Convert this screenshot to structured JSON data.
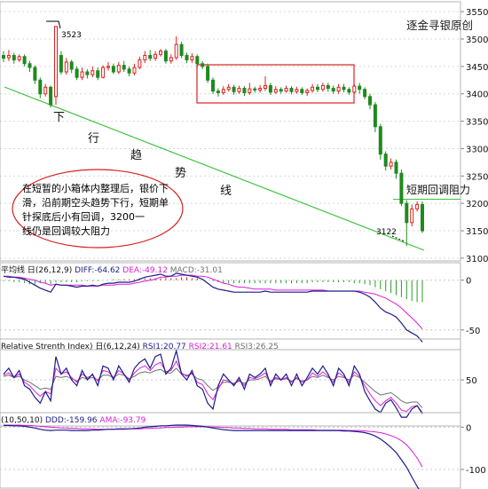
{
  "chart_data": [
    {
      "type": "candlestick",
      "watermark": "逐金寻银原创",
      "y_ticks": [
        3550,
        3500,
        3450,
        3400,
        3350,
        3300,
        3250,
        3200,
        3150,
        3100
      ],
      "ylim": [
        3095,
        3568
      ],
      "candles": [
        [
          3470,
          3465,
          3478,
          3458
        ],
        [
          3466,
          3470,
          3480,
          3460
        ],
        [
          3470,
          3462,
          3475,
          3455
        ],
        [
          3462,
          3468,
          3472,
          3458
        ],
        [
          3468,
          3455,
          3472,
          3450
        ],
        [
          3455,
          3448,
          3460,
          3440
        ],
        [
          3448,
          3425,
          3452,
          3418
        ],
        [
          3425,
          3400,
          3430,
          3392
        ],
        [
          3400,
          3412,
          3418,
          3395
        ],
        [
          3412,
          3380,
          3415,
          3375
        ],
        [
          3395,
          3523,
          3523,
          3380
        ],
        [
          3470,
          3440,
          3478,
          3435
        ],
        [
          3440,
          3458,
          3465,
          3435
        ],
        [
          3458,
          3445,
          3462,
          3438
        ],
        [
          3445,
          3430,
          3450,
          3425
        ],
        [
          3430,
          3440,
          3448,
          3425
        ],
        [
          3440,
          3435,
          3445,
          3428
        ],
        [
          3435,
          3442,
          3450,
          3430
        ],
        [
          3442,
          3430,
          3448,
          3425
        ],
        [
          3430,
          3448,
          3452,
          3428
        ],
        [
          3448,
          3450,
          3458,
          3442
        ],
        [
          3450,
          3440,
          3455,
          3436
        ],
        [
          3440,
          3452,
          3458,
          3436
        ],
        [
          3452,
          3445,
          3460,
          3440
        ],
        [
          3445,
          3438,
          3450,
          3432
        ],
        [
          3438,
          3448,
          3455,
          3434
        ],
        [
          3448,
          3462,
          3468,
          3445
        ],
        [
          3462,
          3470,
          3478,
          3456
        ],
        [
          3470,
          3465,
          3480,
          3460
        ],
        [
          3465,
          3472,
          3478,
          3460
        ],
        [
          3472,
          3478,
          3482,
          3468
        ],
        [
          3478,
          3460,
          3482,
          3455
        ],
        [
          3460,
          3466,
          3472,
          3455
        ],
        [
          3466,
          3490,
          3505,
          3462
        ],
        [
          3490,
          3470,
          3495,
          3465
        ],
        [
          3470,
          3462,
          3475,
          3456
        ],
        [
          3462,
          3468,
          3474,
          3456
        ],
        [
          3468,
          3455,
          3472,
          3448
        ],
        [
          3455,
          3450,
          3460,
          3445
        ],
        [
          3450,
          3425,
          3455,
          3420
        ],
        [
          3425,
          3405,
          3430,
          3400
        ],
        [
          3405,
          3402,
          3410,
          3395
        ],
        [
          3402,
          3408,
          3414,
          3398
        ],
        [
          3408,
          3412,
          3418,
          3404
        ],
        [
          3412,
          3404,
          3416,
          3398
        ],
        [
          3404,
          3410,
          3415,
          3400
        ],
        [
          3410,
          3402,
          3414,
          3396
        ],
        [
          3402,
          3409,
          3420,
          3398
        ],
        [
          3409,
          3407,
          3413,
          3402
        ],
        [
          3407,
          3410,
          3416,
          3402
        ],
        [
          3410,
          3415,
          3432,
          3405
        ],
        [
          3415,
          3403,
          3420,
          3398
        ],
        [
          3403,
          3408,
          3414,
          3400
        ],
        [
          3408,
          3405,
          3412,
          3400
        ],
        [
          3405,
          3410,
          3415,
          3402
        ],
        [
          3410,
          3404,
          3414,
          3399
        ],
        [
          3404,
          3408,
          3413,
          3400
        ],
        [
          3408,
          3402,
          3412,
          3398
        ],
        [
          3402,
          3406,
          3410,
          3396
        ],
        [
          3406,
          3412,
          3418,
          3402
        ],
        [
          3412,
          3408,
          3418,
          3403
        ],
        [
          3408,
          3415,
          3420,
          3404
        ],
        [
          3415,
          3410,
          3420,
          3404
        ],
        [
          3410,
          3405,
          3415,
          3400
        ],
        [
          3405,
          3412,
          3418,
          3400
        ],
        [
          3412,
          3408,
          3418,
          3403
        ],
        [
          3408,
          3403,
          3412,
          3398
        ],
        [
          3403,
          3414,
          3418,
          3400
        ],
        [
          3414,
          3408,
          3420,
          3400
        ],
        [
          3408,
          3395,
          3412,
          3390
        ],
        [
          3395,
          3380,
          3400,
          3372
        ],
        [
          3380,
          3340,
          3385,
          3330
        ],
        [
          3340,
          3290,
          3345,
          3280
        ],
        [
          3290,
          3268,
          3295,
          3260
        ],
        [
          3268,
          3275,
          3282,
          3262
        ],
        [
          3275,
          3255,
          3280,
          3245
        ],
        [
          3255,
          3200,
          3262,
          3195
        ],
        [
          3200,
          3165,
          3206,
          3122
        ],
        [
          3165,
          3190,
          3198,
          3158
        ],
        [
          3190,
          3198,
          3204,
          3185
        ],
        [
          3198,
          3150,
          3204,
          3146
        ]
      ],
      "annotations": {
        "high_label": "3523",
        "low_label": "3122",
        "trend_chars": [
          "下",
          "行",
          "趋",
          "势",
          "线"
        ],
        "resistance_label": "短期回调阻力",
        "note": "在短暂的小箱体内整理后，银价下滑，沿前期空头趋势下行，短期单针探底后小有回调，3200一线仍是回调较大阻力"
      }
    },
    {
      "type": "line",
      "indicator": "MACD",
      "title": "平均线 日(26,12,9)",
      "legend": [
        {
          "name": "DIFF",
          "value": "-64.62",
          "color": "#1c1c8a"
        },
        {
          "name": "DEA",
          "value": "-49.12",
          "color": "#d81ed8"
        },
        {
          "name": "MACD",
          "value": "-31.01",
          "color": "#707070"
        }
      ],
      "y_ticks": [
        0,
        -50
      ],
      "ylim": [
        -68,
        14
      ],
      "histogram": [
        -1,
        -1,
        -2,
        -2,
        -3,
        -4,
        -4,
        -3,
        -3,
        -4,
        -2,
        -2,
        -2,
        -2,
        -2,
        -1,
        -1,
        -1,
        -1,
        0,
        0,
        1,
        1,
        1,
        1,
        1,
        2,
        2,
        2,
        2,
        2,
        2,
        2,
        2,
        3,
        3,
        2,
        2,
        1,
        0,
        -1,
        -2,
        -3,
        -3,
        -3,
        -3,
        -3,
        -3,
        -3,
        -3,
        -3,
        -3,
        -3,
        -3,
        -3,
        -3,
        -3,
        -3,
        -3,
        -2,
        -2,
        -2,
        -2,
        -2,
        -2,
        -2,
        -2,
        -3,
        -3,
        -4,
        -5,
        -7,
        -9,
        -11,
        -13,
        -15,
        -17,
        -19,
        -21,
        -22,
        -22
      ],
      "diff": [
        4,
        3,
        3,
        2,
        1,
        -2,
        -5,
        -8,
        -10,
        -12,
        -4,
        -5,
        -5,
        -6,
        -7,
        -6,
        -6,
        -5,
        -6,
        -4,
        -3,
        -3,
        -2,
        -2,
        -2,
        -1,
        1,
        3,
        4,
        5,
        6,
        4,
        4,
        7,
        6,
        5,
        4,
        3,
        1,
        -3,
        -7,
        -9,
        -10,
        -11,
        -12,
        -12,
        -12,
        -12,
        -12,
        -12,
        -11,
        -12,
        -12,
        -12,
        -12,
        -12,
        -12,
        -12,
        -12,
        -11,
        -11,
        -11,
        -11,
        -11,
        -11,
        -11,
        -11,
        -11,
        -12,
        -14,
        -17,
        -22,
        -28,
        -32,
        -34,
        -37,
        -43,
        -50,
        -53,
        -56,
        -62
      ],
      "dea": [
        4,
        4,
        3,
        3,
        2,
        1,
        0,
        -2,
        -3,
        -5,
        -4,
        -5,
        -5,
        -5,
        -5,
        -5,
        -6,
        -6,
        -6,
        -5,
        -5,
        -5,
        -4,
        -4,
        -4,
        -3,
        -2,
        -1,
        0,
        1,
        3,
        3,
        4,
        4,
        5,
        5,
        5,
        4,
        4,
        3,
        1,
        -1,
        -3,
        -4,
        -6,
        -7,
        -7,
        -8,
        -9,
        -9,
        -9,
        -9,
        -10,
        -10,
        -10,
        -10,
        -10,
        -10,
        -10,
        -10,
        -10,
        -10,
        -11,
        -11,
        -11,
        -11,
        -11,
        -11,
        -11,
        -12,
        -13,
        -14,
        -16,
        -18,
        -21,
        -24,
        -28,
        -33,
        -38,
        -43,
        -49
      ]
    },
    {
      "type": "line",
      "indicator": "RSI",
      "title": "Relative Strenth Index) 日(6,12,24)",
      "legend": [
        {
          "name": "RSI1",
          "value": "20.77",
          "color": "#1c1c8a"
        },
        {
          "name": "RSI2",
          "value": "21.61",
          "color": "#d81ed8"
        },
        {
          "name": "RSI3",
          "value": "26.25",
          "color": "#707070"
        }
      ],
      "y_ticks": [
        50
      ],
      "ylim": [
        12,
        82
      ],
      "rsi1": [
        55,
        60,
        52,
        58,
        45,
        42,
        35,
        30,
        40,
        32,
        70,
        55,
        60,
        50,
        45,
        58,
        50,
        55,
        45,
        62,
        60,
        50,
        62,
        55,
        48,
        60,
        65,
        68,
        60,
        70,
        72,
        55,
        60,
        75,
        55,
        50,
        58,
        45,
        42,
        30,
        25,
        45,
        55,
        50,
        45,
        52,
        42,
        55,
        52,
        55,
        60,
        45,
        55,
        50,
        55,
        45,
        55,
        45,
        52,
        60,
        55,
        62,
        55,
        45,
        60,
        55,
        45,
        62,
        55,
        40,
        32,
        25,
        22,
        30,
        33,
        26,
        18,
        18,
        25,
        28,
        21
      ],
      "rsi2": [
        54,
        56,
        52,
        55,
        48,
        45,
        40,
        36,
        40,
        38,
        60,
        55,
        57,
        52,
        48,
        55,
        52,
        54,
        49,
        58,
        57,
        52,
        58,
        55,
        50,
        56,
        60,
        62,
        58,
        63,
        65,
        57,
        58,
        66,
        56,
        53,
        56,
        48,
        46,
        38,
        33,
        42,
        50,
        49,
        46,
        50,
        45,
        52,
        51,
        53,
        56,
        48,
        52,
        50,
        52,
        48,
        52,
        48,
        50,
        56,
        53,
        57,
        53,
        48,
        56,
        53,
        48,
        57,
        53,
        45,
        38,
        32,
        28,
        32,
        35,
        30,
        24,
        23,
        27,
        28,
        22
      ],
      "rsi3": [
        53,
        54,
        52,
        53,
        50,
        48,
        45,
        42,
        43,
        42,
        53,
        52,
        53,
        51,
        49,
        52,
        51,
        52,
        50,
        54,
        54,
        52,
        55,
        54,
        51,
        53,
        56,
        57,
        56,
        58,
        59,
        56,
        56,
        60,
        55,
        54,
        55,
        51,
        50,
        45,
        41,
        44,
        48,
        48,
        47,
        49,
        47,
        50,
        50,
        51,
        53,
        49,
        51,
        50,
        51,
        49,
        51,
        49,
        50,
        53,
        52,
        54,
        52,
        50,
        53,
        52,
        50,
        54,
        52,
        48,
        44,
        40,
        37,
        38,
        39,
        36,
        32,
        30,
        31,
        31,
        26
      ]
    },
    {
      "type": "line",
      "indicator": "DMA",
      "title": "(10,50,10)",
      "legend": [
        {
          "name": "DDD",
          "value": "-159.96",
          "color": "#1c1c8a"
        },
        {
          "name": "AMA",
          "value": "-93.79",
          "color": "#d81ed8"
        }
      ],
      "y_ticks": [
        0,
        -100
      ],
      "ylim": [
        -140,
        28
      ],
      "ddd": [
        4,
        4,
        3,
        3,
        2,
        0,
        -2,
        -5,
        -7,
        -8,
        -7,
        -7,
        -7,
        -8,
        -8,
        -8,
        -8,
        -7,
        -7,
        -6,
        -5,
        -5,
        -4,
        -4,
        -4,
        -3,
        -2,
        0,
        1,
        2,
        3,
        3,
        4,
        5,
        5,
        5,
        4,
        3,
        2,
        0,
        -2,
        -4,
        -6,
        -7,
        -8,
        -8,
        -8,
        -8,
        -8,
        -8,
        -8,
        -8,
        -8,
        -8,
        -8,
        -8,
        -8,
        -8,
        -8,
        -8,
        -8,
        -8,
        -8,
        -8,
        -8,
        -9,
        -9,
        -10,
        -11,
        -13,
        -16,
        -21,
        -28,
        -37,
        -48,
        -60,
        -77,
        -95,
        -118,
        -140,
        -160
      ],
      "ama": [
        5,
        5,
        5,
        5,
        4,
        4,
        3,
        2,
        1,
        0,
        -1,
        -2,
        -2,
        -3,
        -3,
        -4,
        -4,
        -4,
        -5,
        -5,
        -5,
        -5,
        -5,
        -5,
        -4,
        -4,
        -4,
        -3,
        -3,
        -2,
        -2,
        -1,
        -1,
        0,
        0,
        1,
        1,
        1,
        1,
        1,
        0,
        0,
        -1,
        -1,
        -2,
        -2,
        -3,
        -3,
        -4,
        -4,
        -4,
        -5,
        -5,
        -5,
        -5,
        -6,
        -6,
        -6,
        -6,
        -6,
        -7,
        -7,
        -7,
        -7,
        -7,
        -7,
        -8,
        -8,
        -8,
        -9,
        -10,
        -11,
        -13,
        -16,
        -20,
        -25,
        -32,
        -42,
        -56,
        -73,
        -94
      ]
    }
  ]
}
